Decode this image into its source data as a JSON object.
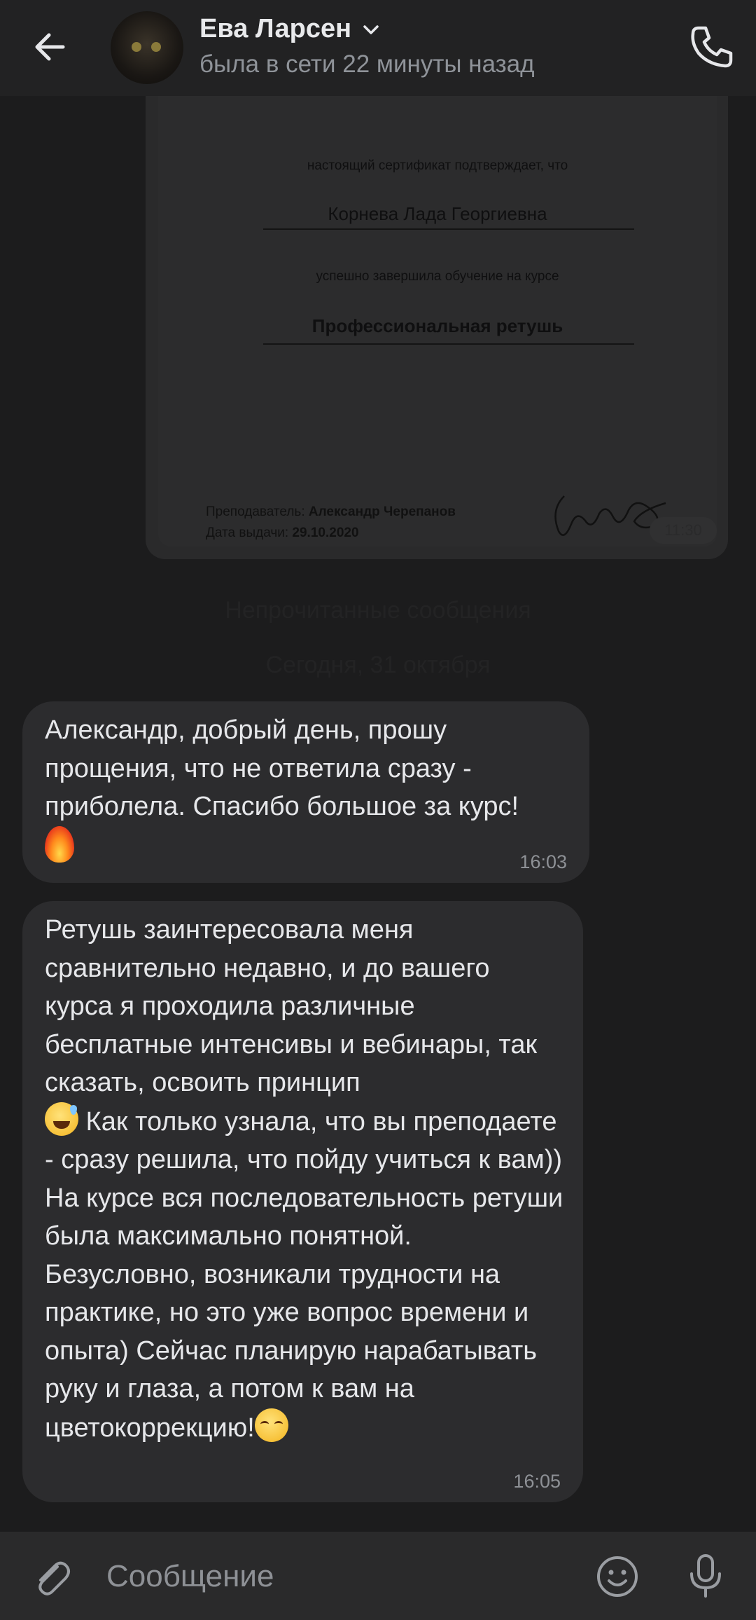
{
  "header": {
    "contact_name": "Ева Ларсен",
    "contact_status": "была в сети 22 минуты назад",
    "back_icon": "arrow-left-icon",
    "call_icon": "phone-icon",
    "dropdown_icon": "chevron-down-icon"
  },
  "certificate": {
    "intro": "настоящий сертификат подтверждает, что",
    "name": "Корнева Лада Георгиевна",
    "completed": "успешно завершила обучение на курсе",
    "course": "Профессиональная ретушь",
    "teacher_label": "Преподаватель:",
    "teacher": "Александр Черепанов",
    "date_label": "Дата выдачи:",
    "date": "29.10.2020",
    "time": "11:30"
  },
  "separators": {
    "unread": "Непрочитанные сообщения",
    "today": "Сегодня, 31 октября"
  },
  "messages": [
    {
      "text": "Александр, добрый день, прошу прощения, что не ответила сразу - приболела. Спасибо большое за курс!",
      "emoji": "fire",
      "time": "16:03"
    },
    {
      "text_before_emoji": "Ретушь заинтересовала меня сравнительно недавно, и до вашего курса я проходила различные бесплатные интенсивы и вебинары, так сказать, освоить принцип",
      "emoji_mid": "grinning-sweat",
      "text_after_emoji": " Как только узнала, что вы преподаете - сразу решила, что пойду учиться к вам)) На курсе вся последовательность ретуши была максимально понятной. Безусловно, возникали трудности на практике, но это уже вопрос времени и опыта) Сейчас планирую нарабатывать руку и глаза, а потом к вам на цветокоррекцию!",
      "emoji_end": "relieved-face",
      "time": "16:05"
    }
  ],
  "composer": {
    "placeholder": "Сообщение",
    "attach_icon": "paperclip-icon",
    "emoji_icon": "smile-icon",
    "mic_icon": "microphone-icon"
  },
  "colors": {
    "background": "#1c1c1d",
    "bubble": "#2c2c2e",
    "header": "#222223",
    "secondary_text": "#8e9196"
  }
}
